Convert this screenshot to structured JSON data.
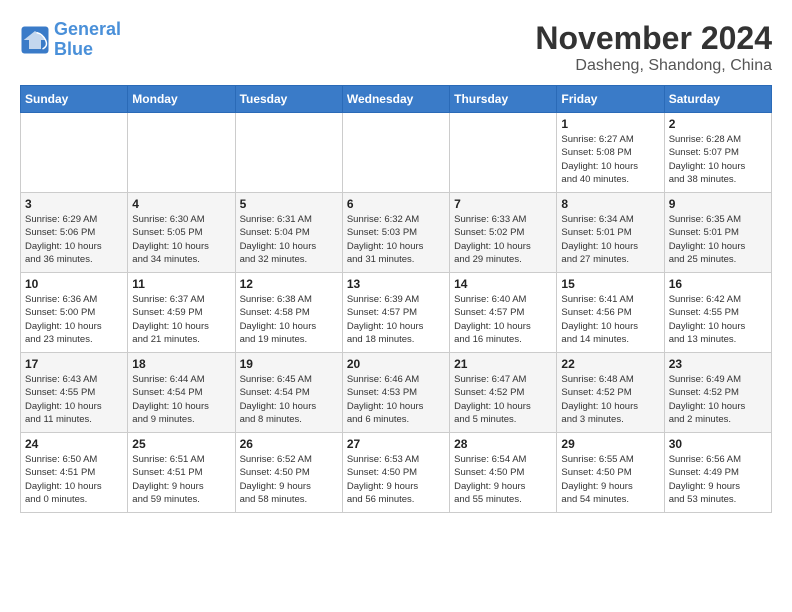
{
  "header": {
    "logo_line1": "General",
    "logo_line2": "Blue",
    "month_title": "November 2024",
    "location": "Dasheng, Shandong, China"
  },
  "days_of_week": [
    "Sunday",
    "Monday",
    "Tuesday",
    "Wednesday",
    "Thursday",
    "Friday",
    "Saturday"
  ],
  "weeks": [
    [
      {
        "day": "",
        "info": ""
      },
      {
        "day": "",
        "info": ""
      },
      {
        "day": "",
        "info": ""
      },
      {
        "day": "",
        "info": ""
      },
      {
        "day": "",
        "info": ""
      },
      {
        "day": "1",
        "info": "Sunrise: 6:27 AM\nSunset: 5:08 PM\nDaylight: 10 hours\nand 40 minutes."
      },
      {
        "day": "2",
        "info": "Sunrise: 6:28 AM\nSunset: 5:07 PM\nDaylight: 10 hours\nand 38 minutes."
      }
    ],
    [
      {
        "day": "3",
        "info": "Sunrise: 6:29 AM\nSunset: 5:06 PM\nDaylight: 10 hours\nand 36 minutes."
      },
      {
        "day": "4",
        "info": "Sunrise: 6:30 AM\nSunset: 5:05 PM\nDaylight: 10 hours\nand 34 minutes."
      },
      {
        "day": "5",
        "info": "Sunrise: 6:31 AM\nSunset: 5:04 PM\nDaylight: 10 hours\nand 32 minutes."
      },
      {
        "day": "6",
        "info": "Sunrise: 6:32 AM\nSunset: 5:03 PM\nDaylight: 10 hours\nand 31 minutes."
      },
      {
        "day": "7",
        "info": "Sunrise: 6:33 AM\nSunset: 5:02 PM\nDaylight: 10 hours\nand 29 minutes."
      },
      {
        "day": "8",
        "info": "Sunrise: 6:34 AM\nSunset: 5:01 PM\nDaylight: 10 hours\nand 27 minutes."
      },
      {
        "day": "9",
        "info": "Sunrise: 6:35 AM\nSunset: 5:01 PM\nDaylight: 10 hours\nand 25 minutes."
      }
    ],
    [
      {
        "day": "10",
        "info": "Sunrise: 6:36 AM\nSunset: 5:00 PM\nDaylight: 10 hours\nand 23 minutes."
      },
      {
        "day": "11",
        "info": "Sunrise: 6:37 AM\nSunset: 4:59 PM\nDaylight: 10 hours\nand 21 minutes."
      },
      {
        "day": "12",
        "info": "Sunrise: 6:38 AM\nSunset: 4:58 PM\nDaylight: 10 hours\nand 19 minutes."
      },
      {
        "day": "13",
        "info": "Sunrise: 6:39 AM\nSunset: 4:57 PM\nDaylight: 10 hours\nand 18 minutes."
      },
      {
        "day": "14",
        "info": "Sunrise: 6:40 AM\nSunset: 4:57 PM\nDaylight: 10 hours\nand 16 minutes."
      },
      {
        "day": "15",
        "info": "Sunrise: 6:41 AM\nSunset: 4:56 PM\nDaylight: 10 hours\nand 14 minutes."
      },
      {
        "day": "16",
        "info": "Sunrise: 6:42 AM\nSunset: 4:55 PM\nDaylight: 10 hours\nand 13 minutes."
      }
    ],
    [
      {
        "day": "17",
        "info": "Sunrise: 6:43 AM\nSunset: 4:55 PM\nDaylight: 10 hours\nand 11 minutes."
      },
      {
        "day": "18",
        "info": "Sunrise: 6:44 AM\nSunset: 4:54 PM\nDaylight: 10 hours\nand 9 minutes."
      },
      {
        "day": "19",
        "info": "Sunrise: 6:45 AM\nSunset: 4:54 PM\nDaylight: 10 hours\nand 8 minutes."
      },
      {
        "day": "20",
        "info": "Sunrise: 6:46 AM\nSunset: 4:53 PM\nDaylight: 10 hours\nand 6 minutes."
      },
      {
        "day": "21",
        "info": "Sunrise: 6:47 AM\nSunset: 4:52 PM\nDaylight: 10 hours\nand 5 minutes."
      },
      {
        "day": "22",
        "info": "Sunrise: 6:48 AM\nSunset: 4:52 PM\nDaylight: 10 hours\nand 3 minutes."
      },
      {
        "day": "23",
        "info": "Sunrise: 6:49 AM\nSunset: 4:52 PM\nDaylight: 10 hours\nand 2 minutes."
      }
    ],
    [
      {
        "day": "24",
        "info": "Sunrise: 6:50 AM\nSunset: 4:51 PM\nDaylight: 10 hours\nand 0 minutes."
      },
      {
        "day": "25",
        "info": "Sunrise: 6:51 AM\nSunset: 4:51 PM\nDaylight: 9 hours\nand 59 minutes."
      },
      {
        "day": "26",
        "info": "Sunrise: 6:52 AM\nSunset: 4:50 PM\nDaylight: 9 hours\nand 58 minutes."
      },
      {
        "day": "27",
        "info": "Sunrise: 6:53 AM\nSunset: 4:50 PM\nDaylight: 9 hours\nand 56 minutes."
      },
      {
        "day": "28",
        "info": "Sunrise: 6:54 AM\nSunset: 4:50 PM\nDaylight: 9 hours\nand 55 minutes."
      },
      {
        "day": "29",
        "info": "Sunrise: 6:55 AM\nSunset: 4:50 PM\nDaylight: 9 hours\nand 54 minutes."
      },
      {
        "day": "30",
        "info": "Sunrise: 6:56 AM\nSunset: 4:49 PM\nDaylight: 9 hours\nand 53 minutes."
      }
    ]
  ]
}
